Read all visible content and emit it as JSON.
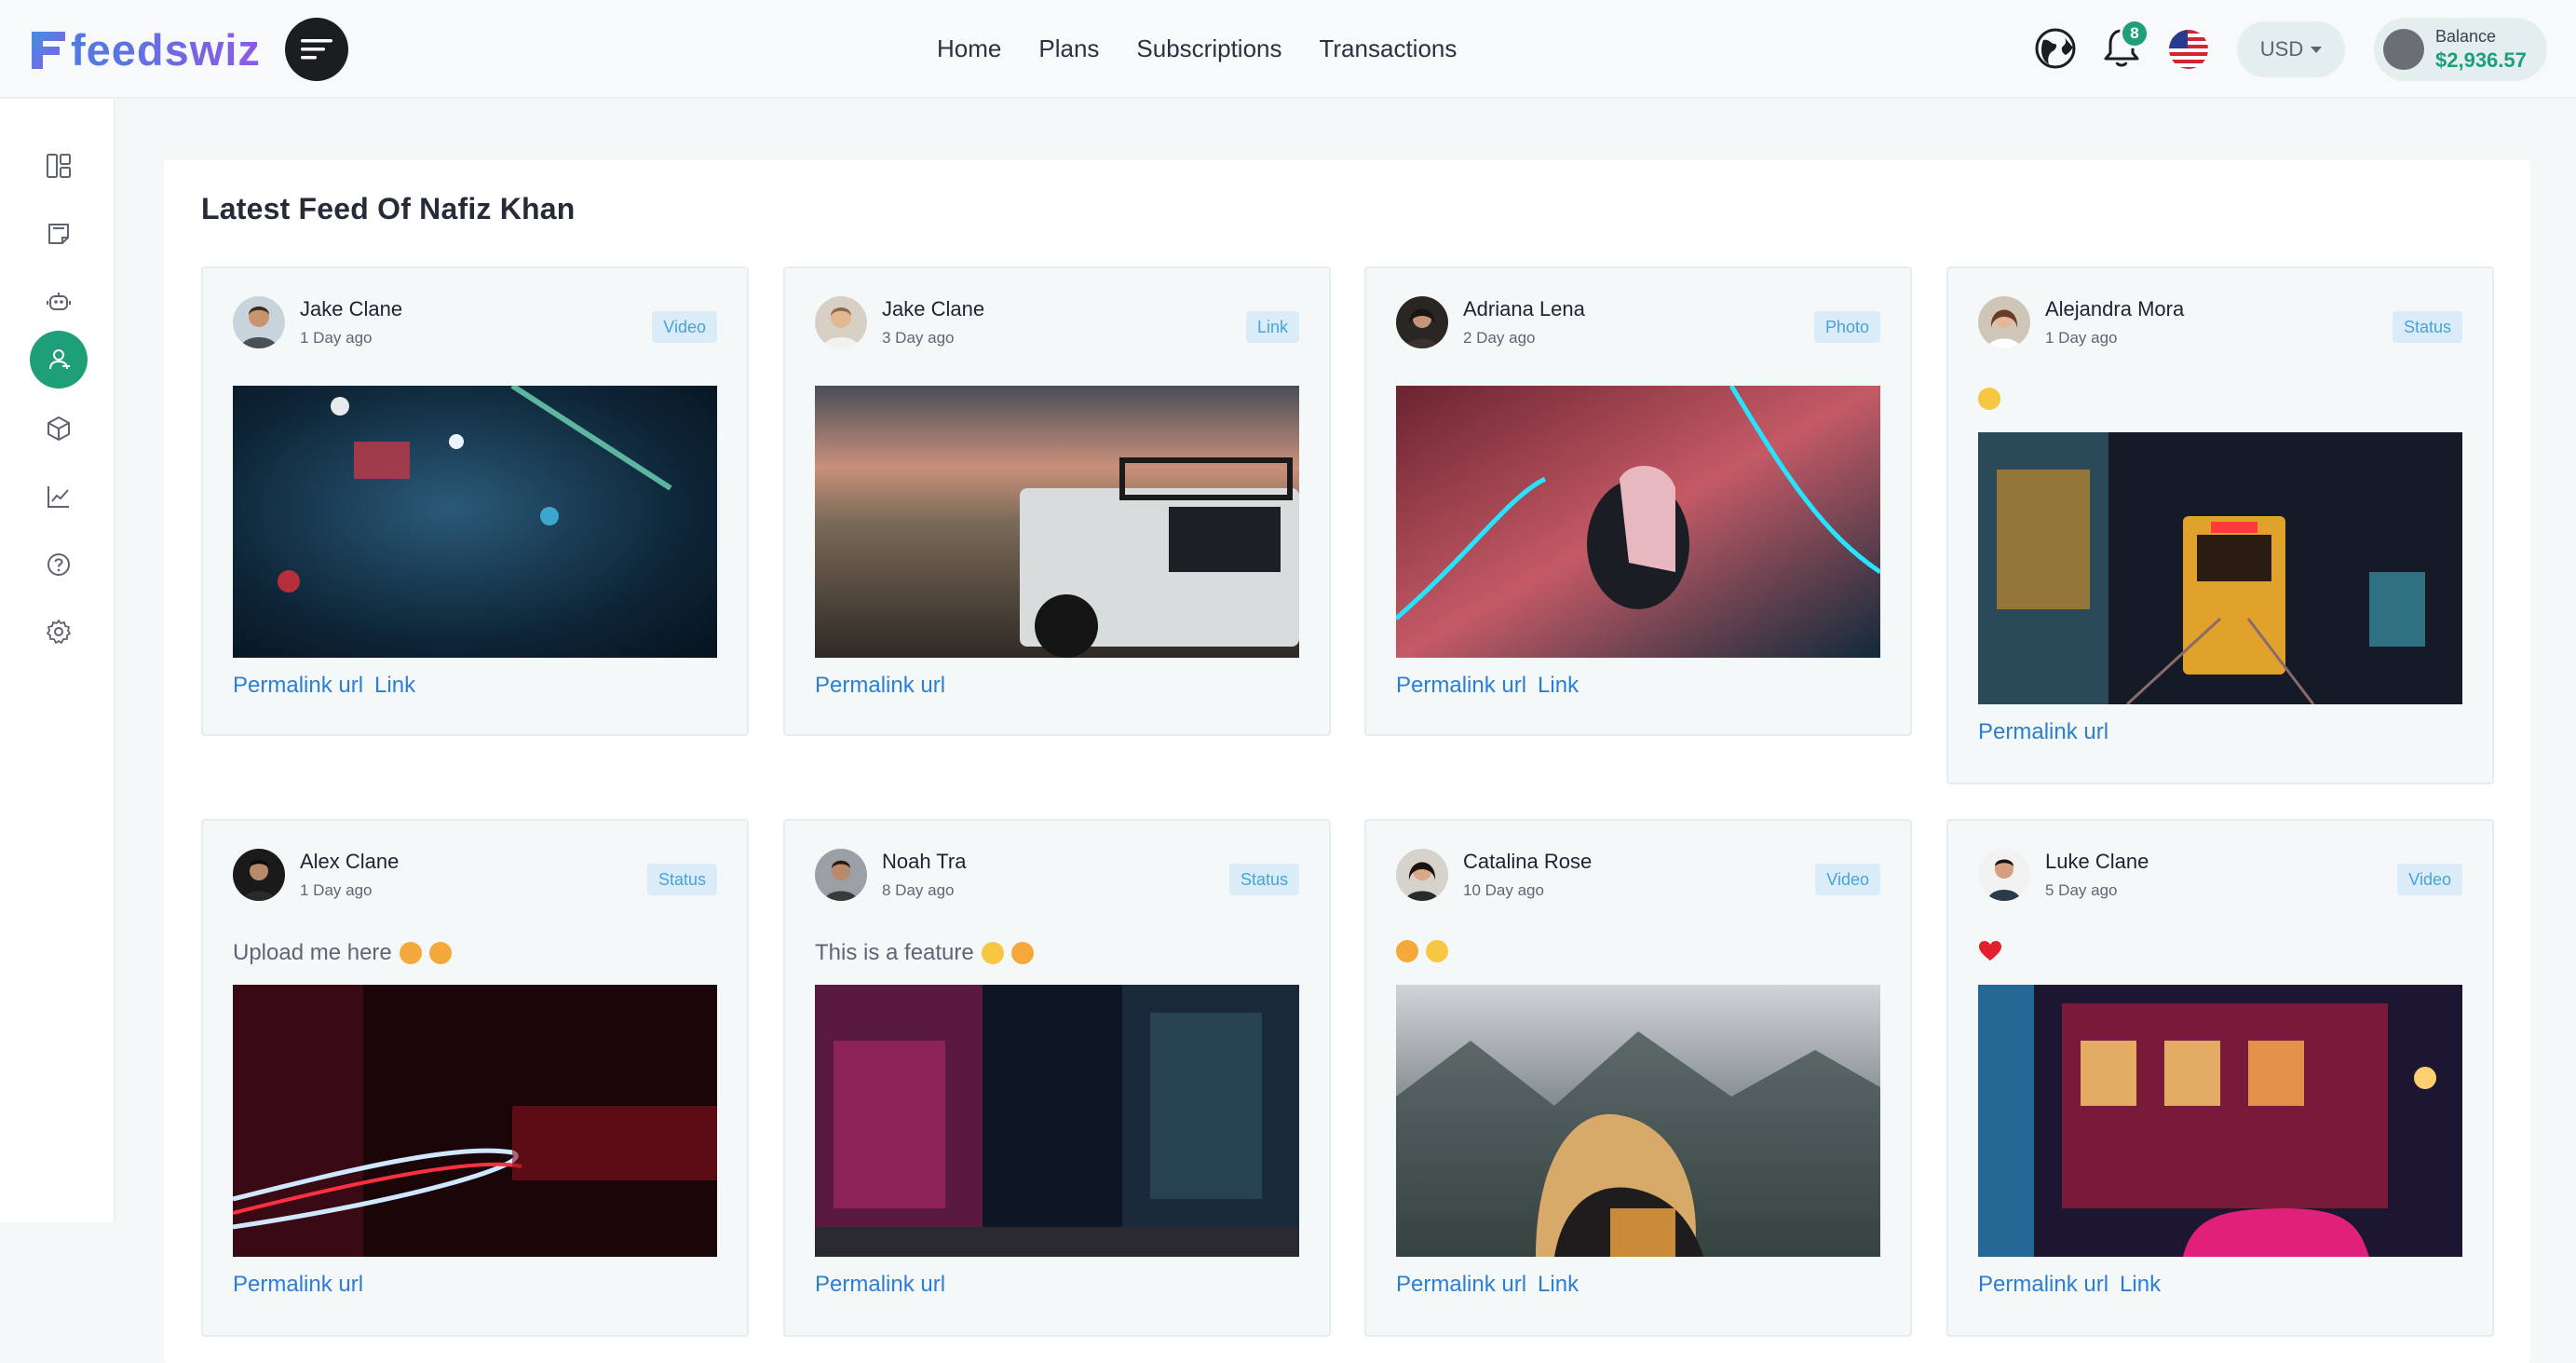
{
  "brand": {
    "name": "feedswiz"
  },
  "nav": {
    "items": [
      "Home",
      "Plans",
      "Subscriptions",
      "Transactions"
    ]
  },
  "header": {
    "notifications_count": "8",
    "currency": "USD",
    "balance_label": "Balance",
    "balance_value": "$2,936.57"
  },
  "sidebar": {
    "items": [
      {
        "icon": "dashboard-icon"
      },
      {
        "icon": "notes-icon"
      },
      {
        "icon": "bot-icon"
      },
      {
        "icon": "user-feed-icon",
        "active": true
      },
      {
        "icon": "package-icon"
      },
      {
        "icon": "chart-icon"
      },
      {
        "icon": "help-icon"
      },
      {
        "icon": "settings-icon"
      }
    ]
  },
  "main": {
    "title": "Latest Feed Of Nafiz Khan",
    "cards": [
      {
        "name": "Jake Clane",
        "time": "1 Day ago",
        "tag": "Video",
        "caption": "",
        "links": [
          "Permalink url",
          "Link"
        ]
      },
      {
        "name": "Jake Clane",
        "time": "3 Day ago",
        "tag": "Link",
        "caption": "",
        "links": [
          "Permalink url"
        ]
      },
      {
        "name": "Adriana Lena",
        "time": "2 Day ago",
        "tag": "Photo",
        "caption": "",
        "links": [
          "Permalink url",
          "Link"
        ]
      },
      {
        "name": "Alejandra Mora",
        "time": "1 Day ago",
        "tag": "Status",
        "caption": "",
        "links": [
          "Permalink url"
        ]
      },
      {
        "name": "Alex Clane",
        "time": "1 Day ago",
        "tag": "Status",
        "caption": "Upload me here",
        "links": [
          "Permalink url"
        ]
      },
      {
        "name": "Noah Tra",
        "time": "8 Day ago",
        "tag": "Status",
        "caption": "This is a feature",
        "links": [
          "Permalink url"
        ]
      },
      {
        "name": "Catalina Rose",
        "time": "10 Day ago",
        "tag": "Video",
        "caption": "",
        "links": [
          "Permalink url",
          "Link"
        ]
      },
      {
        "name": "Luke Clane",
        "time": "5 Day ago",
        "tag": "Video",
        "caption": "",
        "links": [
          "Permalink url",
          "Link"
        ]
      }
    ]
  },
  "colors": {
    "accent": "#1f9f77",
    "link": "#2a7fd4",
    "tag_bg": "#d9ecf7",
    "tag_text": "#4aa3d8"
  }
}
